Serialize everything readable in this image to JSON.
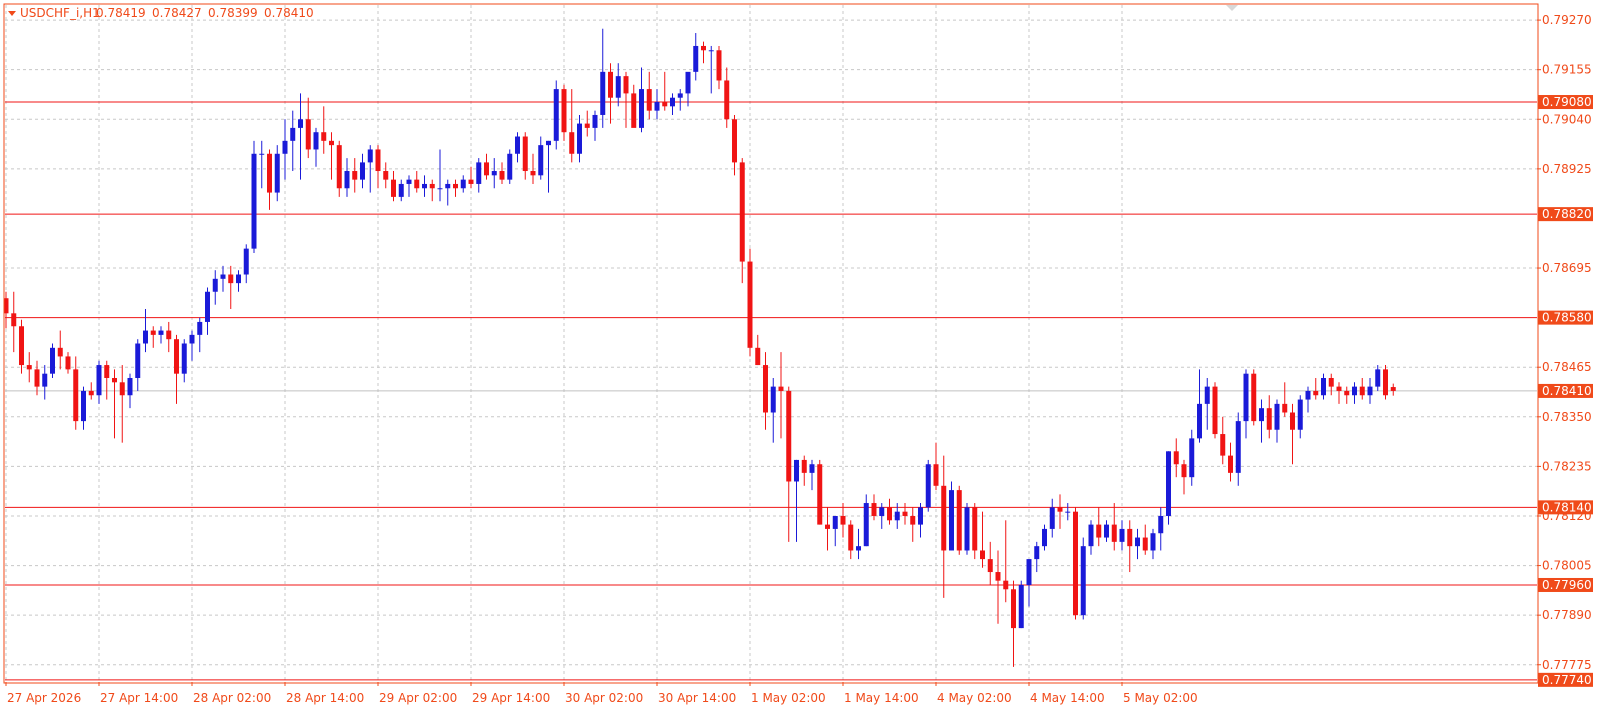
{
  "header": {
    "symbol_label": "USDCHF_i,H1",
    "ohlc": [
      "0.78419",
      "0.78427",
      "0.78399",
      "0.78410"
    ]
  },
  "colors": {
    "background": "#ffffff",
    "grid": "#c8c8c8",
    "frame": "#f04a1a",
    "axis_text": "#f04a1a",
    "bull": "#1a1ad8",
    "bear": "#f01414",
    "level_line": "#f01414",
    "bid_line": "#c0c0c0",
    "tag_fill": "#f04a1a",
    "tag_text": "#ffffff"
  },
  "price_axis": {
    "ticks": [
      "0.79270",
      "0.79155",
      "0.79040",
      "0.78925",
      "0.78695",
      "0.78465",
      "0.78350",
      "0.78235",
      "0.78120",
      "0.78005",
      "0.77890",
      "0.77775"
    ]
  },
  "level_tags": [
    "0.79080",
    "0.78820",
    "0.78580",
    "0.78140",
    "0.77960",
    "0.77740"
  ],
  "current_price_tag": "0.78410",
  "time_axis": {
    "ticks": [
      "27 Apr 2026",
      "27 Apr 14:00",
      "28 Apr 02:00",
      "28 Apr 14:00",
      "29 Apr 02:00",
      "29 Apr 14:00",
      "30 Apr 02:00",
      "30 Apr 14:00",
      "1 May 02:00",
      "1 May 14:00",
      "4 May 02:00",
      "4 May 14:00",
      "5 May 02:00"
    ]
  },
  "chart_data": {
    "type": "candlestick",
    "timeframe": "H1",
    "ylim": [
      0.77735,
      0.79305
    ],
    "levels": [
      0.7908,
      0.7882,
      0.7858,
      0.7814,
      0.7796,
      0.7774
    ],
    "current_price": 0.7841,
    "candles": [
      [
        0.78625,
        0.7864,
        0.78555,
        0.7859
      ],
      [
        0.7859,
        0.7864,
        0.785,
        0.7856
      ],
      [
        0.7856,
        0.78575,
        0.7845,
        0.7847
      ],
      [
        0.7847,
        0.785,
        0.7843,
        0.7846
      ],
      [
        0.7846,
        0.7848,
        0.784,
        0.7842
      ],
      [
        0.7842,
        0.7847,
        0.7839,
        0.7845
      ],
      [
        0.7845,
        0.7852,
        0.7844,
        0.7851
      ],
      [
        0.7851,
        0.7855,
        0.7846,
        0.7849
      ],
      [
        0.7849,
        0.785,
        0.7845,
        0.7846
      ],
      [
        0.7846,
        0.7849,
        0.7832,
        0.7834
      ],
      [
        0.7834,
        0.7842,
        0.7832,
        0.7841
      ],
      [
        0.7841,
        0.7843,
        0.7839,
        0.784
      ],
      [
        0.784,
        0.7848,
        0.7838,
        0.7847
      ],
      [
        0.7847,
        0.7848,
        0.7839,
        0.7844
      ],
      [
        0.7844,
        0.7846,
        0.783,
        0.7843
      ],
      [
        0.7843,
        0.7847,
        0.7829,
        0.784
      ],
      [
        0.784,
        0.7845,
        0.7837,
        0.7844
      ],
      [
        0.7844,
        0.7853,
        0.7841,
        0.7852
      ],
      [
        0.7852,
        0.786,
        0.785,
        0.7855
      ],
      [
        0.7855,
        0.7856,
        0.7851,
        0.7854
      ],
      [
        0.7854,
        0.7856,
        0.7852,
        0.7855
      ],
      [
        0.7855,
        0.7857,
        0.785,
        0.7853
      ],
      [
        0.7853,
        0.7854,
        0.7838,
        0.7845
      ],
      [
        0.7845,
        0.7853,
        0.7843,
        0.7852
      ],
      [
        0.7852,
        0.7855,
        0.7848,
        0.7854
      ],
      [
        0.7854,
        0.7858,
        0.785,
        0.7857
      ],
      [
        0.7857,
        0.7865,
        0.7854,
        0.7864
      ],
      [
        0.7864,
        0.7869,
        0.7861,
        0.7867
      ],
      [
        0.7867,
        0.787,
        0.7864,
        0.7868
      ],
      [
        0.7868,
        0.787,
        0.786,
        0.7866
      ],
      [
        0.7866,
        0.7869,
        0.7864,
        0.7868
      ],
      [
        0.7868,
        0.7875,
        0.7866,
        0.7874
      ],
      [
        0.7874,
        0.7899,
        0.7873,
        0.7896
      ],
      [
        0.7896,
        0.7899,
        0.7888,
        0.7896
      ],
      [
        0.7896,
        0.7897,
        0.7883,
        0.7887
      ],
      [
        0.7887,
        0.7898,
        0.7885,
        0.7896
      ],
      [
        0.7896,
        0.7904,
        0.789,
        0.7899
      ],
      [
        0.7899,
        0.7906,
        0.7892,
        0.7902
      ],
      [
        0.7902,
        0.791,
        0.789,
        0.7904
      ],
      [
        0.7904,
        0.7909,
        0.7895,
        0.7897
      ],
      [
        0.7897,
        0.7902,
        0.7893,
        0.7901
      ],
      [
        0.7901,
        0.7907,
        0.7896,
        0.7899
      ],
      [
        0.7899,
        0.7901,
        0.789,
        0.7898
      ],
      [
        0.7898,
        0.7899,
        0.7886,
        0.7888
      ],
      [
        0.7888,
        0.7895,
        0.7886,
        0.7892
      ],
      [
        0.7892,
        0.7895,
        0.7887,
        0.789
      ],
      [
        0.789,
        0.7896,
        0.7888,
        0.7894
      ],
      [
        0.7894,
        0.7898,
        0.7887,
        0.7897
      ],
      [
        0.7897,
        0.7898,
        0.7888,
        0.7892
      ],
      [
        0.7892,
        0.7894,
        0.7888,
        0.789
      ],
      [
        0.789,
        0.7892,
        0.7885,
        0.7886
      ],
      [
        0.7886,
        0.789,
        0.7885,
        0.7889
      ],
      [
        0.7889,
        0.7891,
        0.7886,
        0.789
      ],
      [
        0.789,
        0.7892,
        0.7887,
        0.7888
      ],
      [
        0.7888,
        0.7891,
        0.7886,
        0.7889
      ],
      [
        0.7889,
        0.789,
        0.7885,
        0.7888
      ],
      [
        0.7888,
        0.7897,
        0.7885,
        0.7888
      ],
      [
        0.7888,
        0.789,
        0.7884,
        0.7889
      ],
      [
        0.7889,
        0.789,
        0.7886,
        0.7888
      ],
      [
        0.7888,
        0.7891,
        0.7887,
        0.789
      ],
      [
        0.789,
        0.7893,
        0.7888,
        0.7889
      ],
      [
        0.7889,
        0.7895,
        0.7887,
        0.7894
      ],
      [
        0.7894,
        0.7896,
        0.789,
        0.7891
      ],
      [
        0.7891,
        0.7895,
        0.7888,
        0.7892
      ],
      [
        0.7892,
        0.7894,
        0.7889,
        0.789
      ],
      [
        0.789,
        0.7897,
        0.7889,
        0.7896
      ],
      [
        0.7896,
        0.7901,
        0.7894,
        0.79
      ],
      [
        0.79,
        0.7901,
        0.789,
        0.7892
      ],
      [
        0.7892,
        0.7896,
        0.7889,
        0.7891
      ],
      [
        0.7891,
        0.79,
        0.789,
        0.7898
      ],
      [
        0.7898,
        0.7899,
        0.7887,
        0.7899
      ],
      [
        0.7899,
        0.7913,
        0.7897,
        0.7911
      ],
      [
        0.7911,
        0.7912,
        0.7899,
        0.7901
      ],
      [
        0.7901,
        0.7911,
        0.7894,
        0.7896
      ],
      [
        0.7896,
        0.7905,
        0.7894,
        0.7903
      ],
      [
        0.7903,
        0.7906,
        0.79,
        0.7902
      ],
      [
        0.7902,
        0.7906,
        0.7899,
        0.7905
      ],
      [
        0.7905,
        0.7925,
        0.7902,
        0.7915
      ],
      [
        0.7915,
        0.7917,
        0.7903,
        0.7909
      ],
      [
        0.7909,
        0.7917,
        0.7907,
        0.7914
      ],
      [
        0.7914,
        0.7915,
        0.7902,
        0.791
      ],
      [
        0.791,
        0.7912,
        0.7903,
        0.7902
      ],
      [
        0.7902,
        0.7916,
        0.7901,
        0.7911
      ],
      [
        0.7911,
        0.7915,
        0.7904,
        0.7906
      ],
      [
        0.7906,
        0.7911,
        0.7904,
        0.7908
      ],
      [
        0.7908,
        0.7915,
        0.7906,
        0.7907
      ],
      [
        0.7907,
        0.791,
        0.7905,
        0.7909
      ],
      [
        0.7909,
        0.7911,
        0.7906,
        0.791
      ],
      [
        0.791,
        0.7914,
        0.7907,
        0.7915
      ],
      [
        0.7915,
        0.7924,
        0.7913,
        0.7921
      ],
      [
        0.7921,
        0.7922,
        0.7917,
        0.792
      ],
      [
        0.792,
        0.7921,
        0.791,
        0.792
      ],
      [
        0.792,
        0.7921,
        0.7911,
        0.7913
      ],
      [
        0.7913,
        0.7916,
        0.7902,
        0.7904
      ],
      [
        0.7904,
        0.7905,
        0.7891,
        0.7894
      ],
      [
        0.7894,
        0.7895,
        0.7866,
        0.7871
      ],
      [
        0.7871,
        0.7874,
        0.7849,
        0.7851
      ],
      [
        0.7851,
        0.7854,
        0.7847,
        0.7847
      ],
      [
        0.7847,
        0.785,
        0.7832,
        0.7836
      ],
      [
        0.7836,
        0.7844,
        0.7829,
        0.7842
      ],
      [
        0.7842,
        0.785,
        0.783,
        0.7841
      ],
      [
        0.7841,
        0.7842,
        0.7806,
        0.782
      ],
      [
        0.782,
        0.7825,
        0.7806,
        0.7825
      ],
      [
        0.7825,
        0.7826,
        0.7819,
        0.7822
      ],
      [
        0.7822,
        0.7825,
        0.7818,
        0.7824
      ],
      [
        0.7824,
        0.7825,
        0.781,
        0.781
      ],
      [
        0.781,
        0.7814,
        0.7804,
        0.7809
      ],
      [
        0.7809,
        0.7812,
        0.7805,
        0.7812
      ],
      [
        0.7812,
        0.7815,
        0.7807,
        0.781
      ],
      [
        0.781,
        0.7811,
        0.7802,
        0.7804
      ],
      [
        0.7804,
        0.7809,
        0.7802,
        0.7805
      ],
      [
        0.7805,
        0.7817,
        0.7805,
        0.7815
      ],
      [
        0.7815,
        0.7817,
        0.7811,
        0.7812
      ],
      [
        0.7812,
        0.7815,
        0.7809,
        0.7814
      ],
      [
        0.7814,
        0.7816,
        0.781,
        0.7811
      ],
      [
        0.7811,
        0.7815,
        0.7809,
        0.7813
      ],
      [
        0.7813,
        0.7815,
        0.781,
        0.7812
      ],
      [
        0.7812,
        0.7814,
        0.7806,
        0.781
      ],
      [
        0.781,
        0.7815,
        0.7807,
        0.7814
      ],
      [
        0.7814,
        0.7825,
        0.7813,
        0.7824
      ],
      [
        0.7824,
        0.7829,
        0.7818,
        0.7819
      ],
      [
        0.7819,
        0.7826,
        0.7793,
        0.7804
      ],
      [
        0.7804,
        0.782,
        0.7804,
        0.7818
      ],
      [
        0.7818,
        0.7819,
        0.7803,
        0.7804
      ],
      [
        0.7804,
        0.7815,
        0.7803,
        0.7814
      ],
      [
        0.7814,
        0.7815,
        0.7802,
        0.7804
      ],
      [
        0.7804,
        0.7813,
        0.78,
        0.7802
      ],
      [
        0.7802,
        0.7806,
        0.7796,
        0.7799
      ],
      [
        0.7799,
        0.7804,
        0.7787,
        0.7797
      ],
      [
        0.7797,
        0.7811,
        0.7792,
        0.7795
      ],
      [
        0.7795,
        0.7797,
        0.7777,
        0.7786
      ],
      [
        0.7786,
        0.7797,
        0.7786,
        0.7796
      ],
      [
        0.7796,
        0.7802,
        0.7791,
        0.7802
      ],
      [
        0.7802,
        0.7806,
        0.7799,
        0.7805
      ],
      [
        0.7805,
        0.781,
        0.7804,
        0.7809
      ],
      [
        0.7809,
        0.7816,
        0.7807,
        0.7814
      ],
      [
        0.7814,
        0.7817,
        0.7809,
        0.7813
      ],
      [
        0.7813,
        0.7815,
        0.7811,
        0.7813
      ],
      [
        0.7813,
        0.7814,
        0.7788,
        0.7789
      ],
      [
        0.7789,
        0.7807,
        0.7788,
        0.7805
      ],
      [
        0.7805,
        0.7811,
        0.7803,
        0.781
      ],
      [
        0.781,
        0.7814,
        0.7805,
        0.7807
      ],
      [
        0.7807,
        0.7811,
        0.7806,
        0.781
      ],
      [
        0.781,
        0.7815,
        0.7804,
        0.7806
      ],
      [
        0.7806,
        0.7811,
        0.7804,
        0.7809
      ],
      [
        0.7809,
        0.7811,
        0.7799,
        0.7805
      ],
      [
        0.7805,
        0.7809,
        0.7802,
        0.7807
      ],
      [
        0.7807,
        0.781,
        0.7803,
        0.7804
      ],
      [
        0.7804,
        0.7809,
        0.7802,
        0.7808
      ],
      [
        0.7808,
        0.7814,
        0.7804,
        0.7812
      ],
      [
        0.7812,
        0.7827,
        0.781,
        0.7827
      ],
      [
        0.7827,
        0.783,
        0.7821,
        0.7824
      ],
      [
        0.7824,
        0.7825,
        0.7817,
        0.7821
      ],
      [
        0.7821,
        0.7832,
        0.7819,
        0.783
      ],
      [
        0.783,
        0.7846,
        0.7829,
        0.7838
      ],
      [
        0.7838,
        0.7844,
        0.7832,
        0.7842
      ],
      [
        0.7842,
        0.7843,
        0.783,
        0.7831
      ],
      [
        0.7831,
        0.7835,
        0.7824,
        0.7826
      ],
      [
        0.7826,
        0.7829,
        0.782,
        0.7822
      ],
      [
        0.7822,
        0.7836,
        0.7819,
        0.7834
      ],
      [
        0.7834,
        0.7846,
        0.783,
        0.7845
      ],
      [
        0.7845,
        0.7846,
        0.7833,
        0.7834
      ],
      [
        0.7834,
        0.7839,
        0.7829,
        0.7837
      ],
      [
        0.7837,
        0.784,
        0.783,
        0.7832
      ],
      [
        0.7832,
        0.7839,
        0.7829,
        0.7838
      ],
      [
        0.7838,
        0.7843,
        0.7835,
        0.7836
      ],
      [
        0.7836,
        0.7838,
        0.7824,
        0.7832
      ],
      [
        0.7832,
        0.784,
        0.783,
        0.7839
      ],
      [
        0.7839,
        0.7842,
        0.7836,
        0.7841
      ],
      [
        0.7841,
        0.7844,
        0.7839,
        0.784
      ],
      [
        0.784,
        0.7845,
        0.7839,
        0.7844
      ],
      [
        0.7844,
        0.7845,
        0.784,
        0.7842
      ],
      [
        0.7842,
        0.7843,
        0.7838,
        0.7841
      ],
      [
        0.7841,
        0.7842,
        0.7838,
        0.784
      ],
      [
        0.784,
        0.7843,
        0.7838,
        0.7842
      ],
      [
        0.7842,
        0.7844,
        0.7839,
        0.784
      ],
      [
        0.784,
        0.7844,
        0.7838,
        0.7842
      ],
      [
        0.7842,
        0.7847,
        0.7841,
        0.7846
      ],
      [
        0.7846,
        0.7847,
        0.7839,
        0.784
      ],
      [
        0.78419,
        0.78427,
        0.78399,
        0.7841
      ]
    ]
  }
}
